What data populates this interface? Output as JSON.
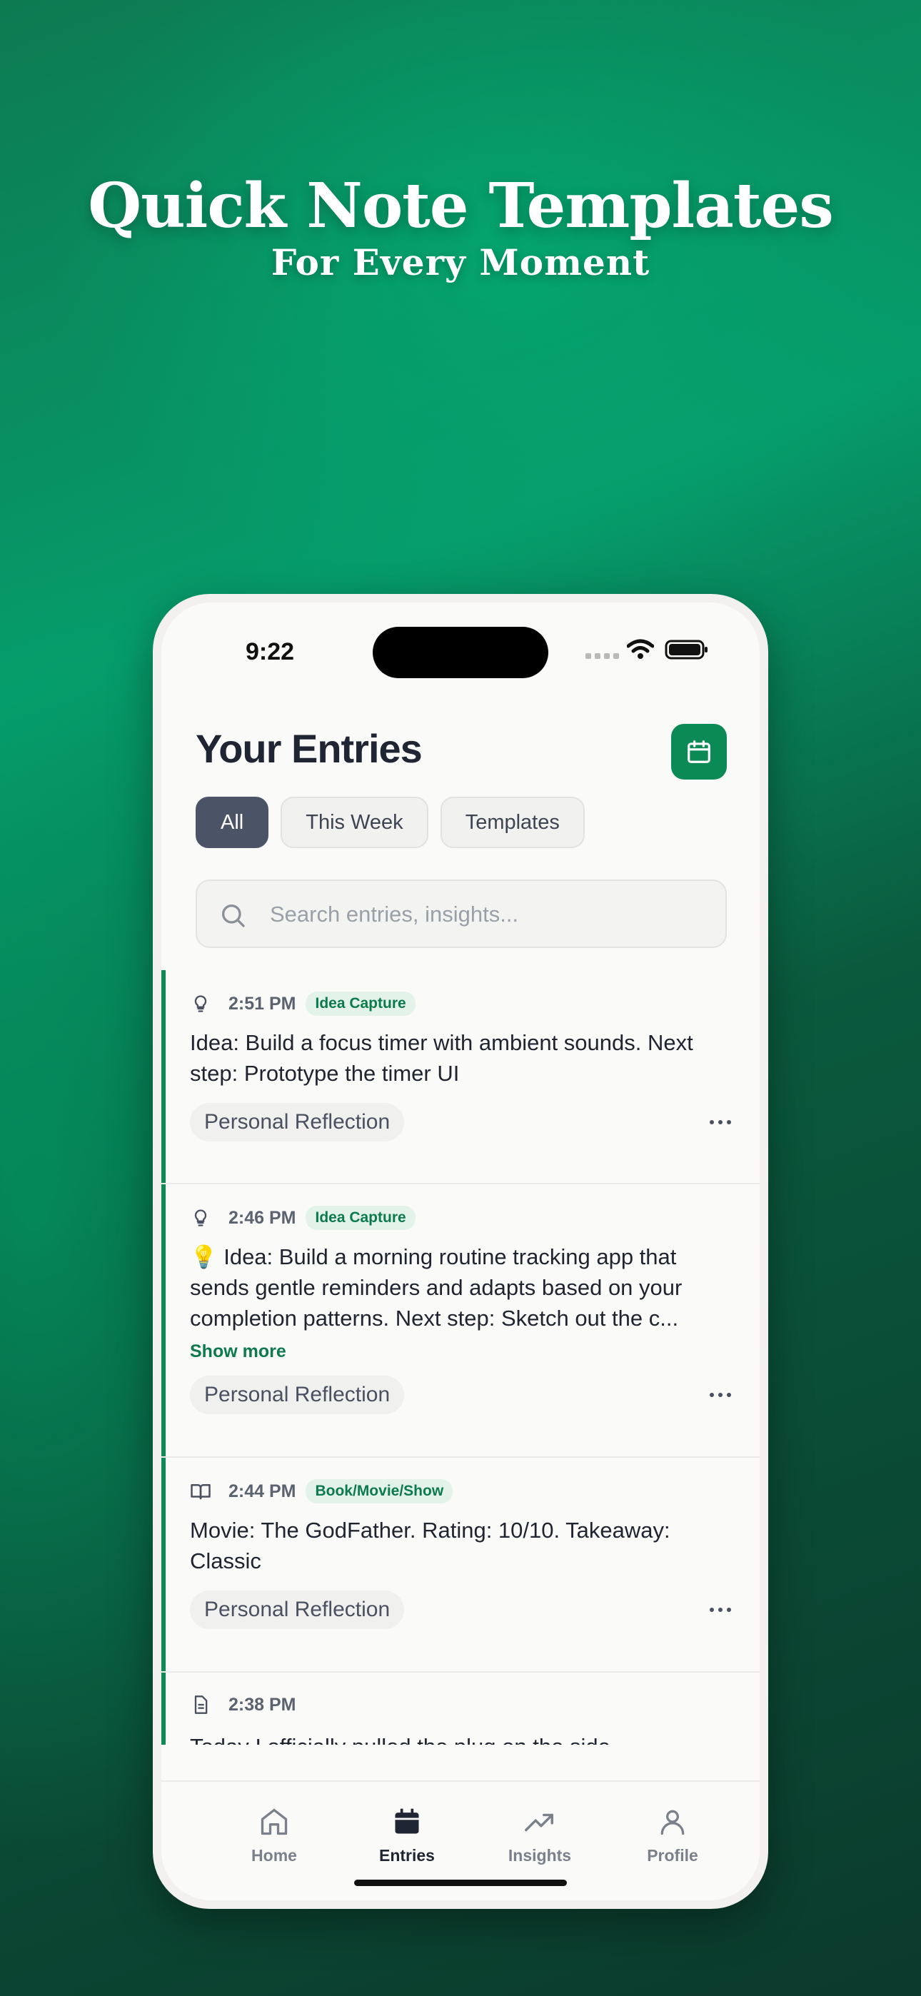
{
  "hero": {
    "title": "Quick Note Templates",
    "subtitle": "For Every Moment"
  },
  "status_bar": {
    "time": "9:22"
  },
  "header": {
    "title": "Your Entries",
    "calendar_icon": "calendar-icon"
  },
  "filters": [
    {
      "label": "All",
      "active": true
    },
    {
      "label": "This Week",
      "active": false
    },
    {
      "label": "Templates",
      "active": false
    }
  ],
  "search": {
    "placeholder": "Search entries, insights...",
    "value": ""
  },
  "entries": [
    {
      "icon": "lightbulb-icon",
      "time": "2:51 PM",
      "tag": "Idea Capture",
      "text": "Idea: Build a focus timer with ambient sounds. Next step: Prototype the timer UI",
      "category": "Personal Reflection"
    },
    {
      "icon": "lightbulb-icon",
      "time": "2:46 PM",
      "tag": "Idea Capture",
      "text": "💡 Idea: Build a morning routine tracking app that sends gentle reminders and adapts based on your completion patterns. Next step: Sketch out the c...",
      "show_more": "Show more",
      "category": "Personal Reflection"
    },
    {
      "icon": "book-icon",
      "time": "2:44 PM",
      "tag": "Book/Movie/Show",
      "text": "Movie: The GodFather. Rating: 10/10. Takeaway: Classic",
      "category": "Personal Reflection"
    },
    {
      "icon": "document-icon",
      "time": "2:38 PM",
      "text": "Today I officially pulled the plug on the side"
    }
  ],
  "tabbar": [
    {
      "label": "Home",
      "icon": "home-icon",
      "active": false
    },
    {
      "label": "Entries",
      "icon": "calendar-icon",
      "active": true
    },
    {
      "label": "Insights",
      "icon": "trending-up-icon",
      "active": false
    },
    {
      "label": "Profile",
      "icon": "user-icon",
      "active": false
    }
  ],
  "colors": {
    "accent": "#0b8a55",
    "chip_active": "#4a5466",
    "tag_text": "#0d7a4c",
    "tag_bg": "#e3f3ea"
  }
}
